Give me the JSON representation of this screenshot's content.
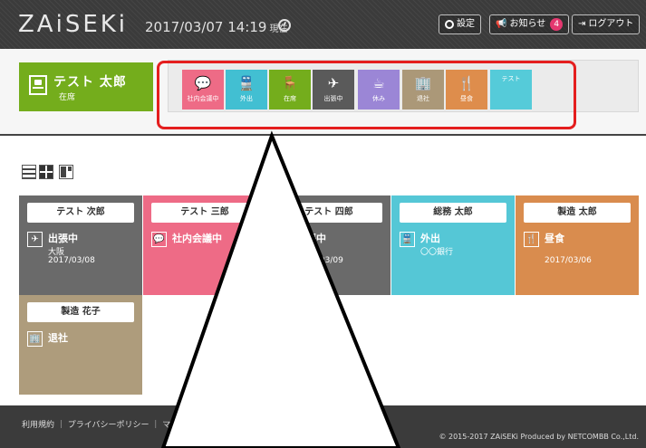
{
  "header": {
    "logo": "ZAiSEKi",
    "datetime": "2017/03/07 14:19",
    "datetime_suffix": "現在",
    "settings_label": "設定",
    "notice_label": "お知らせ",
    "notice_count": "4",
    "logout_label": "ログアウト"
  },
  "me": {
    "name": "テスト 太郎",
    "status": "在席",
    "color": "#74ad1c",
    "icon": "desk-chair-icon"
  },
  "status_buttons": [
    {
      "label": "社内会議中",
      "icon": "speech-bubble-icon",
      "glyph": "💬",
      "color": "#ee6b86"
    },
    {
      "label": "外出",
      "icon": "train-icon",
      "glyph": "🚆",
      "color": "#42bfd2"
    },
    {
      "label": "在席",
      "icon": "desk-chair-icon",
      "glyph": "🪑",
      "color": "#74ad1c"
    },
    {
      "label": "出張中",
      "icon": "airplane-icon",
      "glyph": "✈",
      "color": "#5a5a5a"
    },
    {
      "label": "休み",
      "icon": "coffee-cup-icon",
      "glyph": "☕",
      "color": "#9b86d6"
    },
    {
      "label": "退社",
      "icon": "building-icon",
      "glyph": "🏢",
      "color": "#ab9878"
    },
    {
      "label": "昼食",
      "icon": "fork-knife-icon",
      "glyph": "🍴",
      "color": "#de8d4c"
    },
    {
      "label": "テスト",
      "icon": "",
      "glyph": "",
      "color": "#55cbd9"
    }
  ],
  "members": [
    {
      "name": "テスト 次郎",
      "status": "出張中",
      "detail": "大阪",
      "date": "2017/03/08",
      "color": "#6a6a6a",
      "icon": "airplane-icon",
      "glyph": "✈"
    },
    {
      "name": "テスト 三郎",
      "status": "社内会議中",
      "detail": "",
      "date": "",
      "color": "#ee6b86",
      "icon": "speech-bubble-icon",
      "glyph": "💬"
    },
    {
      "name": "テスト 四郎",
      "status": "出張中",
      "detail": "",
      "date": "2017/03/09",
      "color": "#6a6a6a",
      "icon": "airplane-icon",
      "glyph": "✈"
    },
    {
      "name": "総務 太郎",
      "status": "外出",
      "detail": "〇〇銀行",
      "date": "",
      "color": "#55c7d6",
      "icon": "train-icon",
      "glyph": "🚆"
    },
    {
      "name": "製造 太郎",
      "status": "昼食",
      "detail": "",
      "date": "2017/03/06",
      "color": "#d98c4e",
      "icon": "fork-knife-icon",
      "glyph": "🍴"
    },
    {
      "name": "製造 花子",
      "status": "退社",
      "detail": "",
      "date": "",
      "color": "#ae9c7c",
      "icon": "building-icon",
      "glyph": "🏢"
    }
  ],
  "footer": {
    "links": "利用規約 ｜ プライバシーポリシー ｜ マ",
    "copyright": "© 2015-2017 ZAiSEKi Produced by NETCOMBB Co.,Ltd."
  }
}
